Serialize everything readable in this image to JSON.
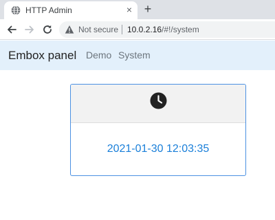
{
  "browser": {
    "tab": {
      "title": "HTTP Admin",
      "close_glyph": "×",
      "favicon": "globe-icon"
    },
    "new_tab_glyph": "+",
    "address_bar": {
      "security_label": "Not secure",
      "url_host": "10.0.2.16",
      "url_rest": "/#!/system"
    }
  },
  "navbar": {
    "brand": "Embox panel",
    "links": [
      "Demo",
      "System"
    ],
    "background": "#e3f0fb"
  },
  "card": {
    "icon": "clock-icon",
    "datetime": "2021-01-30 12:03:35",
    "border_color": "#4a90e2",
    "text_color": "#1a7fd9"
  }
}
